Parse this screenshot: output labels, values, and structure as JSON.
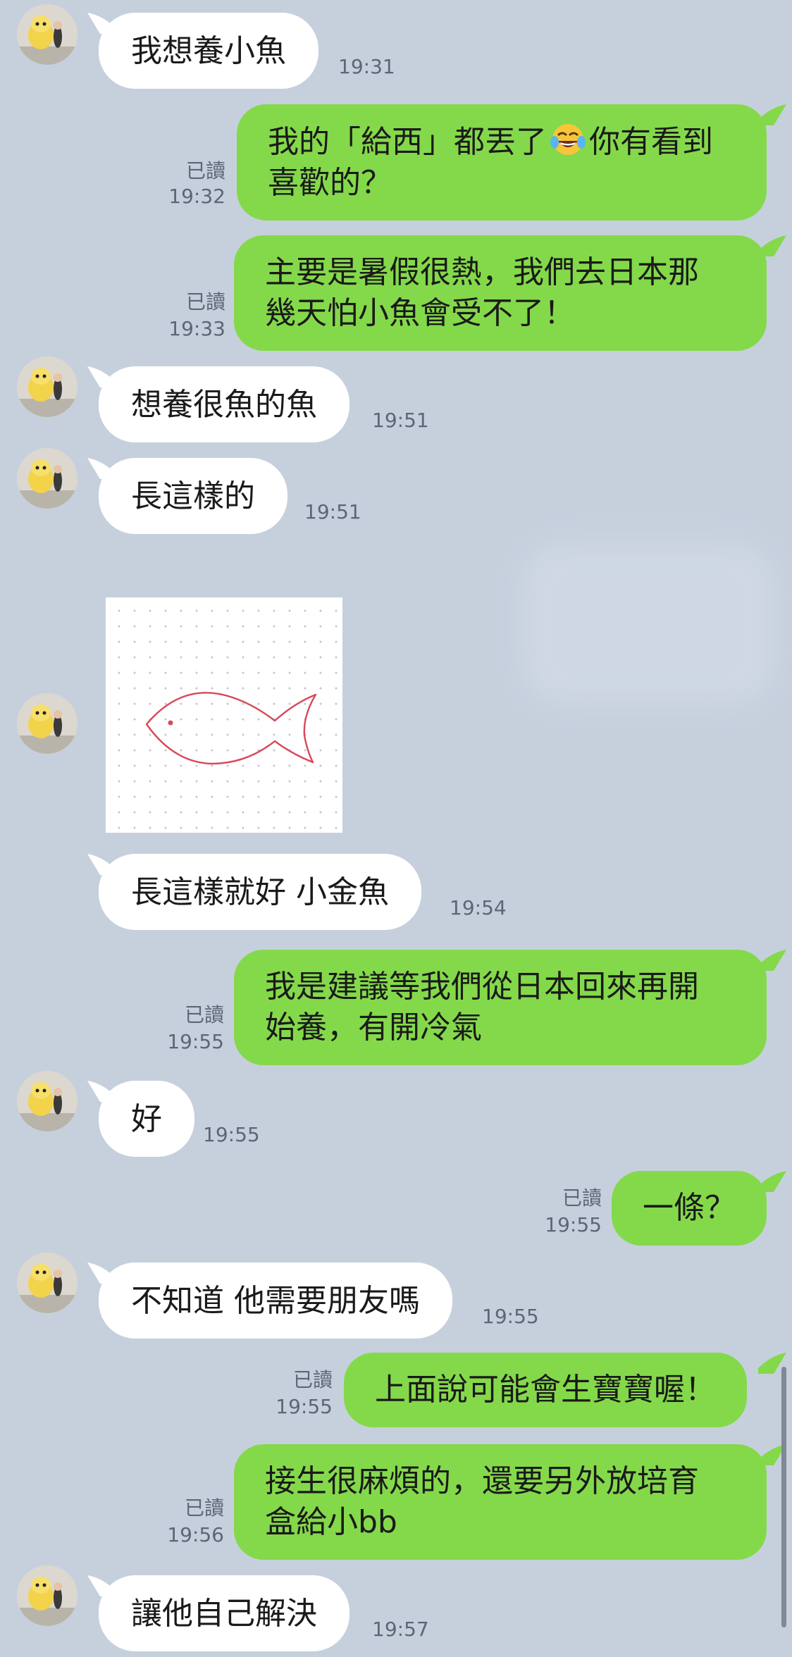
{
  "messages": [
    {
      "id": 1,
      "from": "friend",
      "text": "我想養小魚",
      "time": "19:31"
    },
    {
      "id": 2,
      "from": "me",
      "text_line1_a": "我的「給西」都丟了",
      "emoji": "face-with-tears-of-joy-icon",
      "text_line1_b": "你有看到",
      "text_line2": "喜歡的？",
      "read": "已讀",
      "time": "19:32"
    },
    {
      "id": 3,
      "from": "me",
      "text": "主要是暑假很熱，我們去日本那\n幾天怕小魚會受不了！",
      "read": "已讀",
      "time": "19:33"
    },
    {
      "id": 4,
      "from": "friend",
      "text": "想養很魚的魚",
      "time": "19:51"
    },
    {
      "id": 5,
      "from": "friend",
      "text": "長這樣的",
      "time": "19:51"
    },
    {
      "id": 6,
      "from": "friend",
      "type": "image",
      "image_desc": "fish-drawing"
    },
    {
      "id": 7,
      "from": "friend",
      "text": "長這樣就好 小金魚",
      "time": "19:54"
    },
    {
      "id": 8,
      "from": "me",
      "text": "我是建議等我們從日本回來再開\n始養，有開冷氣",
      "read": "已讀",
      "time": "19:55"
    },
    {
      "id": 9,
      "from": "friend",
      "text": "好",
      "time": "19:55"
    },
    {
      "id": 10,
      "from": "me",
      "text": "一條？",
      "read": "已讀",
      "time": "19:55"
    },
    {
      "id": 11,
      "from": "friend",
      "text": "不知道 他需要朋友嗎",
      "time": "19:55"
    },
    {
      "id": 12,
      "from": "me",
      "text": "上面說可能會生寶寶喔！",
      "read": "已讀",
      "time": "19:55"
    },
    {
      "id": 13,
      "from": "me",
      "text": "接生很麻煩的，還要另外放培育\n盒給小bb",
      "read": "已讀",
      "time": "19:56"
    },
    {
      "id": 14,
      "from": "friend",
      "text": "讓他自己解決",
      "time": "19:57"
    }
  ],
  "colors": {
    "background": "#c6d0dd",
    "incoming_bubble": "#ffffff",
    "outgoing_bubble": "#84d94a",
    "meta_text": "#5c6675"
  }
}
